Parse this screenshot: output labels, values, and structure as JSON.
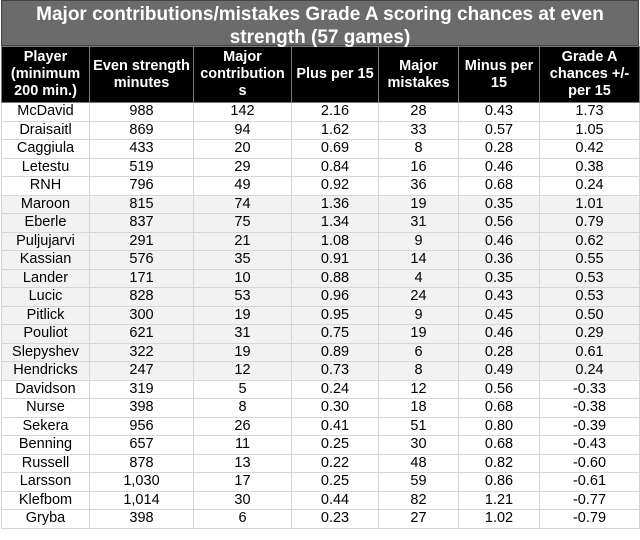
{
  "title": "Major contributions/mistakes Grade A scoring chances at even strength (57 games)",
  "headers": [
    "Player (minimum 200 min.)",
    "Even strength minutes",
    "Major contribution s",
    "Plus per 15",
    "Major mistakes",
    "Minus per 15",
    "Grade A chances +/- per 15"
  ],
  "rows": [
    {
      "player": "McDavid",
      "minutes": "988",
      "contrib": "142",
      "plus15": "2.16",
      "mistakes": "28",
      "minus15": "0.43",
      "net15": "1.73",
      "shade": false
    },
    {
      "player": "Draisaitl",
      "minutes": "869",
      "contrib": "94",
      "plus15": "1.62",
      "mistakes": "33",
      "minus15": "0.57",
      "net15": "1.05",
      "shade": false
    },
    {
      "player": "Caggiula",
      "minutes": "433",
      "contrib": "20",
      "plus15": "0.69",
      "mistakes": "8",
      "minus15": "0.28",
      "net15": "0.42",
      "shade": false
    },
    {
      "player": "Letestu",
      "minutes": "519",
      "contrib": "29",
      "plus15": "0.84",
      "mistakes": "16",
      "minus15": "0.46",
      "net15": "0.38",
      "shade": false
    },
    {
      "player": "RNH",
      "minutes": "796",
      "contrib": "49",
      "plus15": "0.92",
      "mistakes": "36",
      "minus15": "0.68",
      "net15": "0.24",
      "shade": false
    },
    {
      "player": "Maroon",
      "minutes": "815",
      "contrib": "74",
      "plus15": "1.36",
      "mistakes": "19",
      "minus15": "0.35",
      "net15": "1.01",
      "shade": true
    },
    {
      "player": "Eberle",
      "minutes": "837",
      "contrib": "75",
      "plus15": "1.34",
      "mistakes": "31",
      "minus15": "0.56",
      "net15": "0.79",
      "shade": true
    },
    {
      "player": "Puljujarvi",
      "minutes": "291",
      "contrib": "21",
      "plus15": "1.08",
      "mistakes": "9",
      "minus15": "0.46",
      "net15": "0.62",
      "shade": true
    },
    {
      "player": "Kassian",
      "minutes": "576",
      "contrib": "35",
      "plus15": "0.91",
      "mistakes": "14",
      "minus15": "0.36",
      "net15": "0.55",
      "shade": true
    },
    {
      "player": "Lander",
      "minutes": "171",
      "contrib": "10",
      "plus15": "0.88",
      "mistakes": "4",
      "minus15": "0.35",
      "net15": "0.53",
      "shade": true
    },
    {
      "player": "Lucic",
      "minutes": "828",
      "contrib": "53",
      "plus15": "0.96",
      "mistakes": "24",
      "minus15": "0.43",
      "net15": "0.53",
      "shade": true
    },
    {
      "player": "Pitlick",
      "minutes": "300",
      "contrib": "19",
      "plus15": "0.95",
      "mistakes": "9",
      "minus15": "0.45",
      "net15": "0.50",
      "shade": true
    },
    {
      "player": "Pouliot",
      "minutes": "621",
      "contrib": "31",
      "plus15": "0.75",
      "mistakes": "19",
      "minus15": "0.46",
      "net15": "0.29",
      "shade": true
    },
    {
      "player": "Slepyshev",
      "minutes": "322",
      "contrib": "19",
      "plus15": "0.89",
      "mistakes": "6",
      "minus15": "0.28",
      "net15": "0.61",
      "shade": true
    },
    {
      "player": "Hendricks",
      "minutes": "247",
      "contrib": "12",
      "plus15": "0.73",
      "mistakes": "8",
      "minus15": "0.49",
      "net15": "0.24",
      "shade": true
    },
    {
      "player": "Davidson",
      "minutes": "319",
      "contrib": "5",
      "plus15": "0.24",
      "mistakes": "12",
      "minus15": "0.56",
      "net15": "-0.33",
      "shade": false
    },
    {
      "player": "Nurse",
      "minutes": "398",
      "contrib": "8",
      "plus15": "0.30",
      "mistakes": "18",
      "minus15": "0.68",
      "net15": "-0.38",
      "shade": false
    },
    {
      "player": "Sekera",
      "minutes": "956",
      "contrib": "26",
      "plus15": "0.41",
      "mistakes": "51",
      "minus15": "0.80",
      "net15": "-0.39",
      "shade": false
    },
    {
      "player": "Benning",
      "minutes": "657",
      "contrib": "11",
      "plus15": "0.25",
      "mistakes": "30",
      "minus15": "0.68",
      "net15": "-0.43",
      "shade": false
    },
    {
      "player": "Russell",
      "minutes": "878",
      "contrib": "13",
      "plus15": "0.22",
      "mistakes": "48",
      "minus15": "0.82",
      "net15": "-0.60",
      "shade": false
    },
    {
      "player": "Larsson",
      "minutes": "1,030",
      "contrib": "17",
      "plus15": "0.25",
      "mistakes": "59",
      "minus15": "0.86",
      "net15": "-0.61",
      "shade": false
    },
    {
      "player": "Klefbom",
      "minutes": "1,014",
      "contrib": "30",
      "plus15": "0.44",
      "mistakes": "82",
      "minus15": "1.21",
      "net15": "-0.77",
      "shade": false
    },
    {
      "player": "Gryba",
      "minutes": "398",
      "contrib": "6",
      "plus15": "0.23",
      "mistakes": "27",
      "minus15": "1.02",
      "net15": "-0.79",
      "shade": false
    }
  ],
  "colors": {
    "title_bg": "#6b6b6b",
    "header_bg": "#000000",
    "shade_row": "#f2f2f2"
  }
}
